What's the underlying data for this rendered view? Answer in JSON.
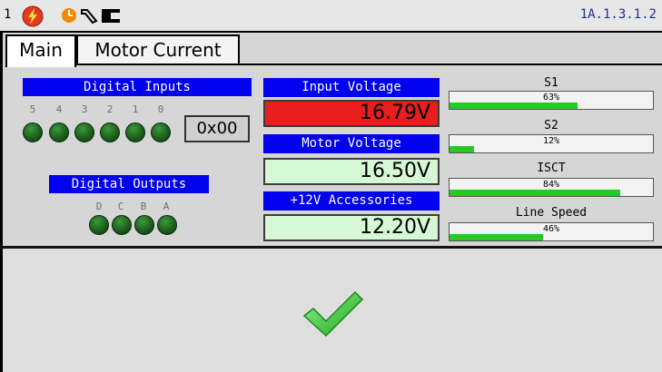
{
  "header": {
    "screen_number": "1",
    "address": "1A.1.3.1.2",
    "icons": [
      "alert-lightning-icon",
      "clock-icon",
      "wrench-icon",
      "plug-icon"
    ]
  },
  "tabs": [
    {
      "label": "Main",
      "active": true
    },
    {
      "label": "Motor Current",
      "active": false
    }
  ],
  "digital_inputs": {
    "title": "Digital Inputs",
    "bits": [
      "5",
      "4",
      "3",
      "2",
      "1",
      "0"
    ],
    "hex_value": "0x00"
  },
  "digital_outputs": {
    "title": "Digital Outputs",
    "bits": [
      "D",
      "C",
      "B",
      "A"
    ]
  },
  "voltages": {
    "input": {
      "label": "Input Voltage",
      "value": "16.79V",
      "color": "#e81e1e"
    },
    "motor": {
      "label": "Motor Voltage",
      "value": "16.50V",
      "color": "#d6f8d6"
    },
    "accessories": {
      "label": "+12V Accessories",
      "value": "12.20V",
      "color": "#d6f8d6"
    }
  },
  "bars": [
    {
      "label": "S1",
      "percent": 63,
      "text": "63%"
    },
    {
      "label": "S2",
      "percent": 12,
      "text": "12%"
    },
    {
      "label": "ISCT",
      "percent": 84,
      "text": "84%"
    },
    {
      "label": "Line Speed",
      "percent": 46,
      "text": "46%"
    }
  ],
  "colors": {
    "accent_blue": "#0000ee",
    "led_green": "#1d5f1d",
    "bar_green": "#22cc22",
    "alarm_red": "#e81e1e"
  },
  "status_icon": "checkmark-icon"
}
